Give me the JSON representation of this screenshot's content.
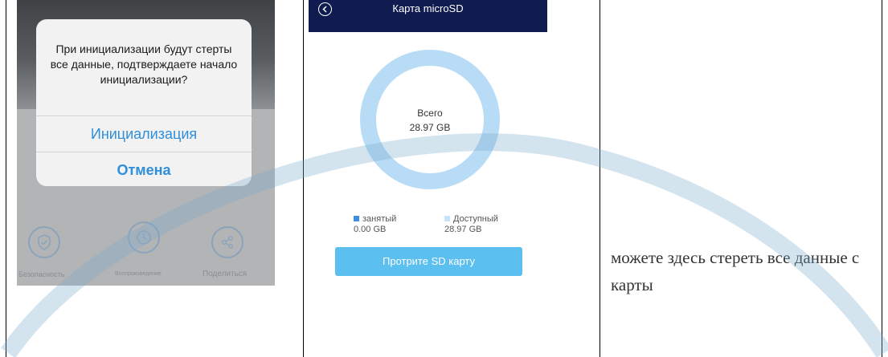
{
  "left_screenshot": {
    "dialog": {
      "message": "При инициализации будут стерты все данные, подтверждаете начало инициализации?",
      "confirm_label": "Инициализация",
      "cancel_label": "Отмена"
    },
    "bottom_bar": [
      {
        "label": "Безопасность",
        "icon": "shield-check-icon"
      },
      {
        "label": "Воспроизведение",
        "icon": "playback-clock-icon"
      },
      {
        "label": "Поделиться",
        "icon": "share-icon"
      }
    ]
  },
  "middle_screenshot": {
    "title": "Карта microSD",
    "total_label": "Всего",
    "total_value": "28.97 GB",
    "used_label": "занятый",
    "used_value": "0.00 GB",
    "available_label": "Доступный",
    "available_value": "28.97 GB",
    "wipe_button": "Протрите SD карту",
    "colors": {
      "topbar": "#101c50",
      "ring": "#b9dcf6",
      "used": "#3f8fe0",
      "available": "#c7e3f8",
      "button": "#5bbff0"
    }
  },
  "right_cell": {
    "text": "можете здесь стереть все данные с карты"
  }
}
